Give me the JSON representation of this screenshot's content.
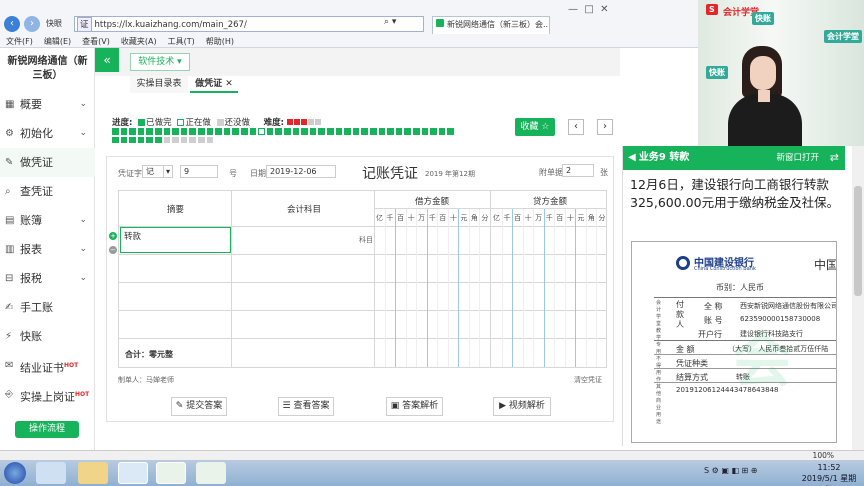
{
  "browser": {
    "fast_label": "快眼",
    "chip_label": "证",
    "url": "https://lx.kuaizhang.com/main_267/",
    "tab_title": "新锐网络通信（新三板）会...",
    "menu": [
      "文件(F)",
      "编辑(E)",
      "查看(V)",
      "收藏夹(A)",
      "工具(T)",
      "帮助(H)"
    ],
    "nav_back": "‹",
    "nav_forward": "›"
  },
  "sidebar": {
    "company_line1": "新锐网络通信（新",
    "company_line2": "三板）",
    "items": [
      {
        "label": "概要",
        "icon": "grid-icon",
        "chevron": true
      },
      {
        "label": "初始化",
        "icon": "gear-icon",
        "chevron": true
      },
      {
        "label": "做凭证",
        "icon": "pen-icon",
        "chevron": false
      },
      {
        "label": "查凭证",
        "icon": "search-icon",
        "chevron": false
      },
      {
        "label": "账簿",
        "icon": "book-icon",
        "chevron": true
      },
      {
        "label": "报表",
        "icon": "report-icon",
        "chevron": true
      },
      {
        "label": "报税",
        "icon": "tax-icon",
        "chevron": true
      },
      {
        "label": "手工账",
        "icon": "hand-icon",
        "chevron": false
      },
      {
        "label": "快账",
        "icon": "quick-icon",
        "chevron": false
      },
      {
        "label": "结业证书",
        "icon": "certificate-icon",
        "chevron": false,
        "badge": "HOT"
      },
      {
        "label": "实操上岗证",
        "icon": "license-icon",
        "chevron": false,
        "badge": "HOT"
      }
    ],
    "flow_button": "操作流程"
  },
  "toolbar": {
    "collapse_symbol": "«",
    "software_button": "软件技术",
    "tabs": [
      {
        "label": "实操目录表",
        "active": false
      },
      {
        "label": "做凭证",
        "active": true
      }
    ]
  },
  "progress": {
    "label": "进度:",
    "done": "已做完",
    "doing": "正在做",
    "todo": "还没做",
    "difficulty_label": "难度:",
    "difficulty_filled": 3,
    "difficulty_total": 5,
    "cells_done": 46,
    "cells_current_index": 17,
    "cells_total": 52,
    "favorite": "收藏 ☆",
    "prev": "‹",
    "next": "›"
  },
  "voucher": {
    "word_label": "凭证字",
    "word_value": "记",
    "number_value": "9",
    "number_suffix": "号",
    "date_label": "日期",
    "date_value": "2019-12-06",
    "title": "记账凭证",
    "period": "2019 年第12期",
    "attach_label": "附单据",
    "attach_value": "2",
    "attach_suffix": "张",
    "col_summary": "摘要",
    "col_account": "会计科目",
    "col_debit": "借方金额",
    "col_credit": "贷方金额",
    "digit_units": [
      "亿",
      "千",
      "百",
      "十",
      "万",
      "千",
      "百",
      "十",
      "元",
      "角",
      "分"
    ],
    "row1_summary": "转款",
    "row1_account_hint": "科目",
    "total_label": "合计：零元整",
    "maker": "制单人：马婵老师",
    "clear": "清空凭证",
    "buttons": [
      "提交答案",
      "查看答案",
      "答案解析",
      "视频解析"
    ]
  },
  "task_panel": {
    "title": "业务9 转款",
    "new_window": "新窗口打开",
    "description": "12月6日，建设银行向工商银行转款325,600.00元用于缴纳税金及社保。",
    "bank_name": "中国建设银行",
    "bank_name_en": "China Construction Bank",
    "heading_partial": "中国",
    "currency": "币别：人民币",
    "payer_label": "付款人",
    "name_label": "全 称",
    "name_value": "西安新锐网络通信股份有限公司",
    "acct_label": "账 号",
    "acct_value": "6235900001587300​08",
    "bank_label": "开户行",
    "bank_value": "建设银行科技路支行",
    "amount_label": "金 额",
    "amount_value": "（大写） 人民币叁拾贰万伍仟陆",
    "type_label": "凭证种类",
    "method_label": "结算方式",
    "method_value": "转账",
    "serial": "20191206124443478643848",
    "side_note": "会计学堂教学专用 不得用作其他商业用途"
  },
  "video_overlay": {
    "logo_left": "会计学堂",
    "logo_s": "S",
    "brand_marks": [
      "快账",
      "会计学堂",
      "快账"
    ]
  },
  "status_bar": {
    "zoom": "100%"
  },
  "taskbar": {
    "time": "11:52",
    "date": "2019/5/1 星期三"
  },
  "colors": {
    "accent": "#17b35b",
    "browser_blue": "#3c7fd6",
    "hot": "#e4262a"
  }
}
